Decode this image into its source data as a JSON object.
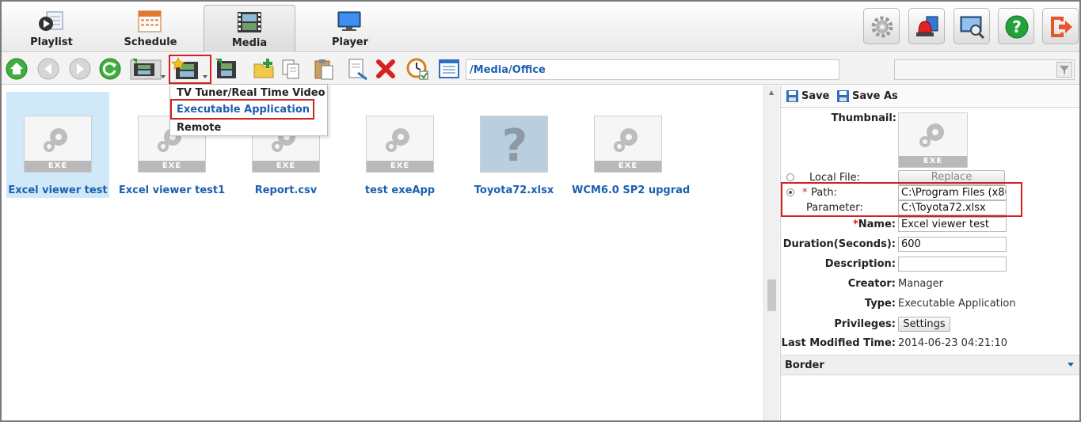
{
  "tabs": [
    {
      "label": "Playlist",
      "icon": "playlist-icon"
    },
    {
      "label": "Schedule",
      "icon": "calendar-icon"
    },
    {
      "label": "Media",
      "icon": "filmstrip-icon",
      "active": true
    },
    {
      "label": "Player",
      "icon": "monitor-icon"
    }
  ],
  "right_buttons": [
    "settings-gear-icon",
    "alarm-light-icon",
    "monitor-search-icon",
    "help-icon",
    "logout-icon"
  ],
  "toolbar": {
    "path": "/Media/Office",
    "search_value": ""
  },
  "dropdown": {
    "items": [
      "TV Tuner/Real Time Video",
      "Executable Application",
      "Remote"
    ]
  },
  "files": [
    {
      "name": "Excel viewer test",
      "badge": "EXE",
      "selected": true
    },
    {
      "name": "Excel viewer test1",
      "badge": "EXE"
    },
    {
      "name": "Report.csv",
      "badge": "EXE"
    },
    {
      "name": "test exeApp",
      "badge": "EXE"
    },
    {
      "name": "Toyota72.xlsx",
      "badge": ""
    },
    {
      "name": "WCM6.0 SP2 upgrad",
      "badge": "EXE"
    }
  ],
  "panel": {
    "save_label": "Save",
    "save_as_label": "Save As",
    "thumbnail_label": "Thumbnail:",
    "thumbnail_badge": "EXE",
    "local_file_label": "Local File:",
    "replace_label": "Replace",
    "required_mark": "*",
    "path_label": "Path:",
    "path_value": "C:\\Program Files (x86",
    "parameter_label": "Parameter:",
    "parameter_value": "C:\\Toyota72.xlsx",
    "name_label": "Name:",
    "name_value": "Excel viewer test",
    "duration_label": "Duration(Seconds):",
    "duration_value": "600",
    "description_label": "Description:",
    "description_value": "",
    "creator_label": "Creator:",
    "creator_value": "Manager",
    "type_label": "Type:",
    "type_value": "Executable Application",
    "privileges_label": "Privileges:",
    "settings_label": "Settings",
    "modified_label": "Last Modified Time:",
    "modified_value": "2014-06-23 04:21:10",
    "border_label": "Border"
  },
  "colors": {
    "link": "#1b5fae",
    "highlight": "#d42020",
    "selected_bg": "#cfe9f9"
  }
}
